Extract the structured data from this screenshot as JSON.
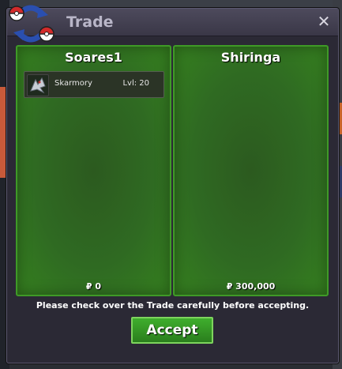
{
  "window": {
    "title": "Trade",
    "close_label": "✕"
  },
  "left_panel": {
    "player_name": "Soares1",
    "money": "₽ 0",
    "items": [
      {
        "name": "Skarmory",
        "level": "Lvl: 20",
        "icon": "skarmory-icon"
      }
    ]
  },
  "right_panel": {
    "player_name": "Shiringa",
    "money": "₽ 300,000",
    "items": []
  },
  "notice": "Please check over the Trade carefully before accepting.",
  "accept_label": "Accept",
  "colors": {
    "panel_green": "#2f6a22",
    "panel_border": "#3f9a27",
    "accept_green": "#3fae2d",
    "window_bg": "#2b2935"
  }
}
